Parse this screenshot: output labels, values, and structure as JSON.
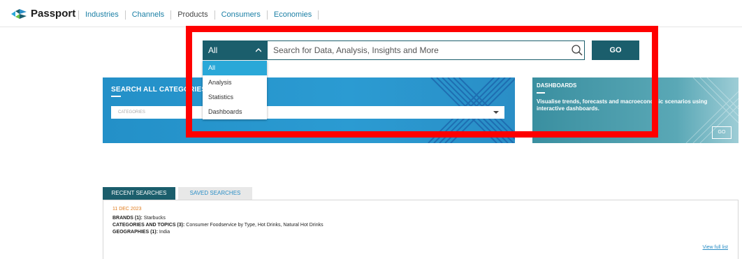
{
  "app": {
    "name": "Passport"
  },
  "nav": {
    "items": [
      {
        "label": "Industries"
      },
      {
        "label": "Channels"
      },
      {
        "label": "Products"
      },
      {
        "label": "Consumers"
      },
      {
        "label": "Economies"
      }
    ]
  },
  "search": {
    "type_selected": "All",
    "placeholder": "Search for Data, Analysis, Insights and More",
    "go_label": "GO",
    "dropdown_options": [
      {
        "label": "All"
      },
      {
        "label": "Analysis"
      },
      {
        "label": "Statistics"
      },
      {
        "label": "Dashboards"
      }
    ]
  },
  "categories": {
    "title": "SEARCH ALL CATEGORIES",
    "select_placeholder": "CATEGORIES"
  },
  "dashboards": {
    "title": "DASHBOARDS",
    "description": "Visualise trends, forecasts and macroeconomic scenarios using interactive dashboards.",
    "go_label": "GO"
  },
  "searches": {
    "tab_recent": "RECENT SEARCHES",
    "tab_saved": "SAVED SEARCHES",
    "entry": {
      "date": "11 DEC 2023",
      "brands_label": "BRANDS (1):",
      "brands_value": "Starbucks",
      "categories_label": "CATEGORIES AND TOPICS (3):",
      "categories_value": "Consumer Foodservice by Type, Hot Drinks, Natural Hot Drinks",
      "geographies_label": "GEOGRAPHIES (1):",
      "geographies_value": "India"
    },
    "view_full_list": "View full list"
  },
  "colors": {
    "brand_teal": "#1b5e6c",
    "accent_blue": "#2aa8d8",
    "highlight_red": "#ff0000",
    "date_orange": "#e07a1a"
  },
  "icons": [
    "passport-logo-icon",
    "chevron-up-icon",
    "search-icon",
    "caret-down-icon"
  ]
}
